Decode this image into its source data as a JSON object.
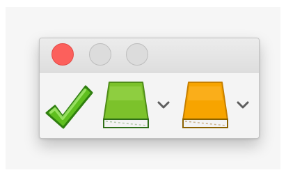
{
  "window": {
    "title": ""
  },
  "titlebar": {
    "buttons": [
      {
        "name": "close",
        "color": "#fc605c"
      },
      {
        "name": "minimize",
        "color": "#dcdcdc"
      },
      {
        "name": "zoom",
        "color": "#dcdcdc"
      }
    ]
  },
  "toolbar": {
    "items": [
      {
        "icon": "checkmark-icon",
        "color": "#5fbf1f"
      },
      {
        "icon": "book-icon",
        "color": "#7cc22b",
        "has_dropdown": true
      },
      {
        "icon": "book-icon",
        "color": "#f7a400",
        "has_dropdown": true
      }
    ]
  }
}
